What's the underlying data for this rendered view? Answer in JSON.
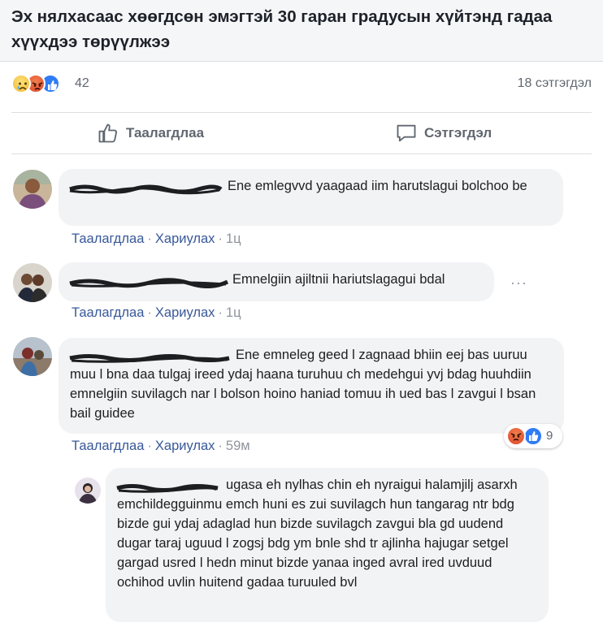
{
  "post": {
    "title": "Эх нялхасаас хөөгдсөн эмэгтэй 30 гаран градусын хүйтэнд гадаа хүүхдээ төрүүлжээ"
  },
  "reactions": {
    "icons": [
      "sad-icon",
      "angry-icon",
      "like-icon"
    ],
    "count": "42",
    "comments_count": "18 сэтгэгдэл"
  },
  "actions": {
    "like_label": "Таалагдлаа",
    "comment_label": "Сэтгэгдэл"
  },
  "comments": [
    {
      "text": "Ene emlegvvd yaagaad iim harutslagui bolchoo be",
      "like_label": "Таалагдлаа",
      "reply_label": "Хариулах",
      "time": "1ц"
    },
    {
      "text": "Emnelgiin ajiltnii hariutslagagui bdal",
      "like_label": "Таалагдлаа",
      "reply_label": "Хариулах",
      "time": "1ц"
    },
    {
      "text": "Ene emneleg geed l zagnaad bhiin eej bas uuruu muu l bna daa tulgaj ireed ydaj haana turuhuu ch medehgui yvj bdag huuhdiin emnelgiin suvilagch nar l bolson hoino haniad tomuu ih ued bas l zavgui l bsan bail guidee",
      "like_label": "Таалагдлаа",
      "reply_label": "Хариулах",
      "time": "59м",
      "reaction_count": "9"
    }
  ],
  "reply": {
    "text": "ugasa eh nylhas chin eh nyraigui halamjilj asarxh emchildegguinmu emch huni es zui suvilagch hun tangarag ntr bdg bizde gui ydaj adaglad hun bizde suvilagch zavgui bla gd uudend dugar taraj uguud l zogsj bdg ym bnle shd tr ajlinha hajugar setgel gargad usred l hedn minut bizde yanaa inged avral ired uvduud ochihod uvlin huitend gadaa turuuled bvl"
  },
  "colors": {
    "link": "#385898",
    "bubble": "#f2f3f5",
    "header_bg": "#f5f6f7",
    "muted": "#606770"
  }
}
